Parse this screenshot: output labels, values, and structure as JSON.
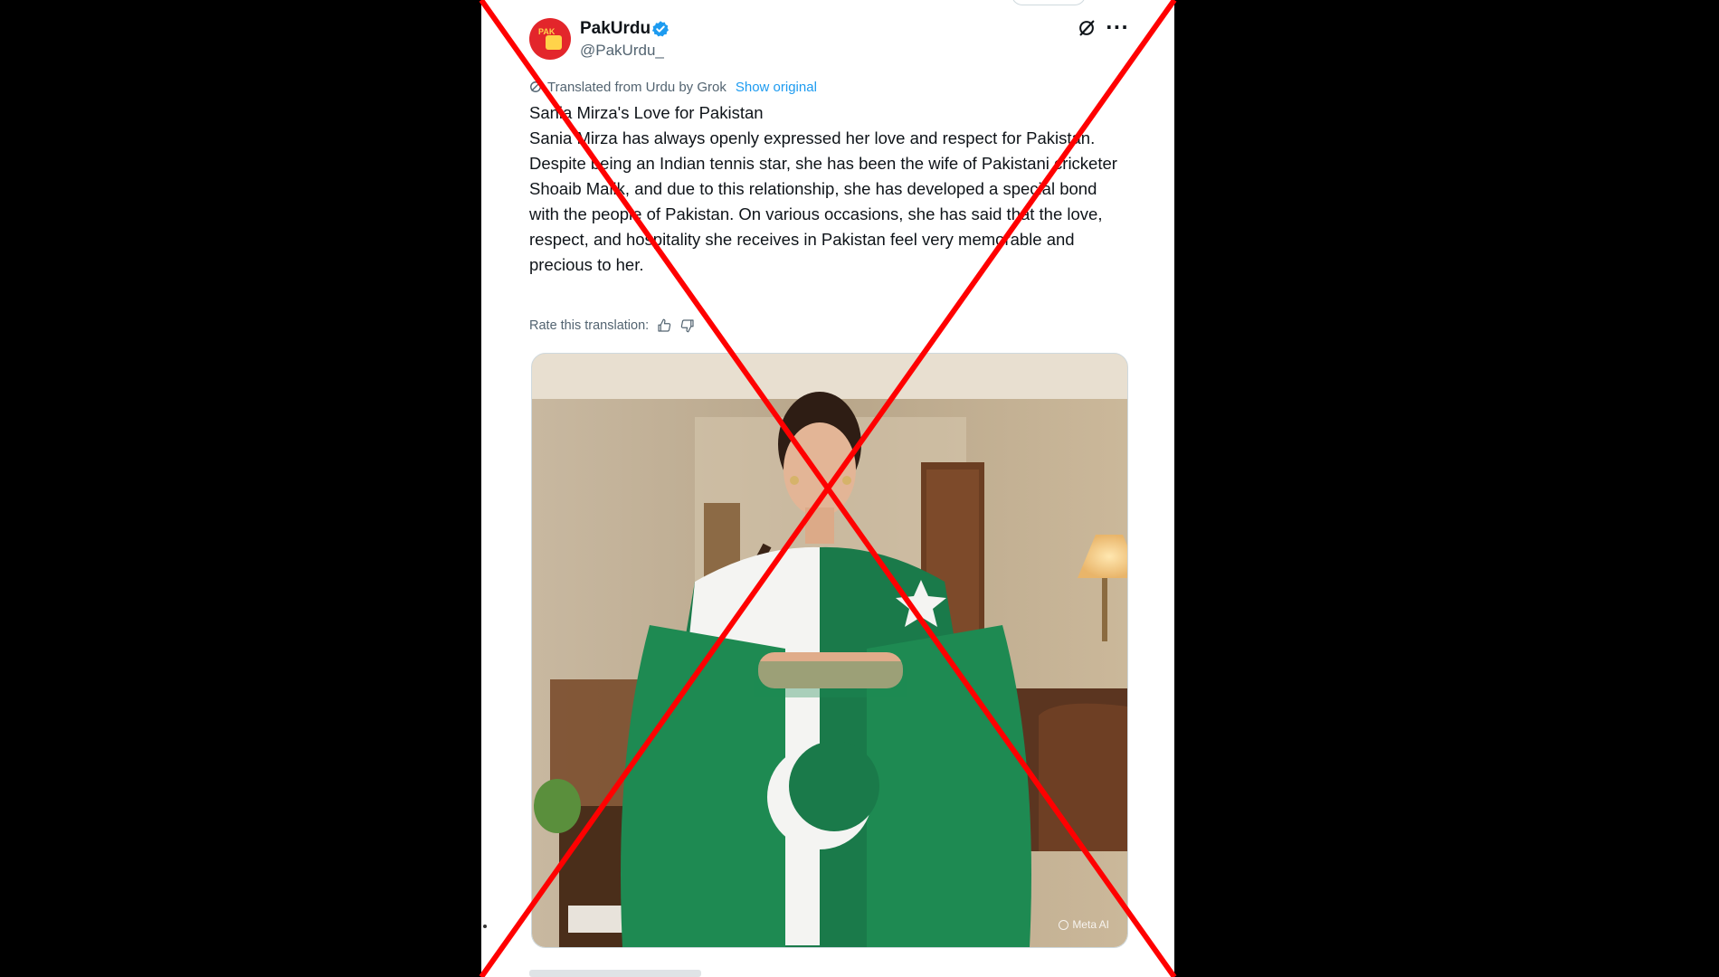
{
  "tweet": {
    "display_name": "PakUrdu",
    "handle": "@PakUrdu_",
    "avatar_text": "PAK",
    "translation_note": "Translated from Urdu by Grok",
    "show_original": "Show original",
    "text_lines": [
      "Sania Mirza's Love for Pakistan",
      "Sania Mirza has always openly expressed her love and respect for Pakistan.",
      "Despite being an Indian tennis star, she has been the wife of Pakistani cricketer Shoaib Malik, and due to this relationship, she has developed a special bond with the people of Pakistan. On various occasions, she has said that the love, respect, and hospitality she receives in Pakistan feel very memorable and precious to her."
    ],
    "rate_label": "Rate this translation:",
    "media_watermark": "Meta AI"
  },
  "icons": {
    "verified": "verified-badge-icon",
    "grok": "grok-icon",
    "more": "more-icon",
    "thumbs_up": "thumbs-up-icon",
    "thumbs_down": "thumbs-down-icon"
  },
  "colors": {
    "accent": "#1d9bf0",
    "cross": "#ff0000",
    "flag_green": "#1a7a4a",
    "avatar": "#e3262b"
  }
}
